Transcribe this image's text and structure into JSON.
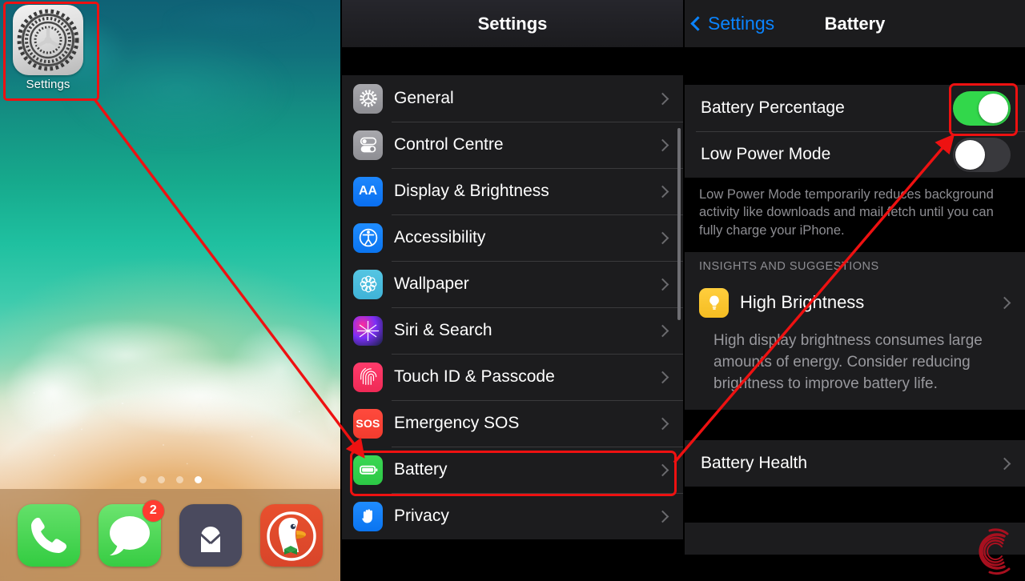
{
  "home": {
    "app": {
      "label": "Settings",
      "icon": "gear-icon"
    },
    "page_dots": {
      "count": 4,
      "active_index": 3
    },
    "dock": [
      {
        "name": "Phone",
        "icon": "phone-icon",
        "badge": ""
      },
      {
        "name": "Messages",
        "icon": "message-bubble-icon",
        "badge": "2"
      },
      {
        "name": "ProtonMail",
        "icon": "envelope-lock-icon",
        "badge": ""
      },
      {
        "name": "DuckDuckGo",
        "icon": "duck-icon",
        "badge": ""
      }
    ]
  },
  "settings_panel": {
    "title": "Settings",
    "rows": [
      {
        "label": "General",
        "icon": "gear-icon",
        "icon_class": "gen"
      },
      {
        "label": "Control Centre",
        "icon": "sliders-icon",
        "icon_class": "cc"
      },
      {
        "label": "Display & Brightness",
        "icon": "aa-icon",
        "icon_class": "aa"
      },
      {
        "label": "Accessibility",
        "icon": "accessibility-icon",
        "icon_class": "acc"
      },
      {
        "label": "Wallpaper",
        "icon": "flower-icon",
        "icon_class": "wall-i"
      },
      {
        "label": "Siri & Search",
        "icon": "siri-icon",
        "icon_class": "siri"
      },
      {
        "label": "Touch ID & Passcode",
        "icon": "fingerprint-icon",
        "icon_class": "touchid"
      },
      {
        "label": "Emergency SOS",
        "icon": "sos-icon",
        "icon_class": "sos"
      },
      {
        "label": "Battery",
        "icon": "battery-icon",
        "icon_class": "batt"
      },
      {
        "label": "Privacy",
        "icon": "hand-icon",
        "icon_class": "priv"
      }
    ],
    "highlighted_row": "Battery"
  },
  "battery_panel": {
    "back_label": "Settings",
    "title": "Battery",
    "toggles": [
      {
        "label": "Battery Percentage",
        "state": "on",
        "highlighted": true
      },
      {
        "label": "Low Power Mode",
        "state": "off",
        "highlighted": false
      }
    ],
    "footnote": "Low Power Mode temporarily reduces background activity like downloads and mail fetch until you can fully charge your iPhone.",
    "section_header": "INSIGHTS AND SUGGESTIONS",
    "insight": {
      "label": "High Brightness",
      "icon": "lightbulb-icon",
      "description": "High display brightness consumes large amounts of energy. Consider reducing brightness to improve battery life."
    },
    "health_row": {
      "label": "Battery Health"
    }
  },
  "annotations": {
    "highlight_color": "#ee1111",
    "arrows": [
      {
        "from": "settings-app-icon",
        "to": "battery-row"
      },
      {
        "from": "battery-row",
        "to": "battery-percentage-toggle"
      }
    ]
  },
  "watermark": {
    "name": "c-logo-watermark",
    "color": "#b01020"
  }
}
